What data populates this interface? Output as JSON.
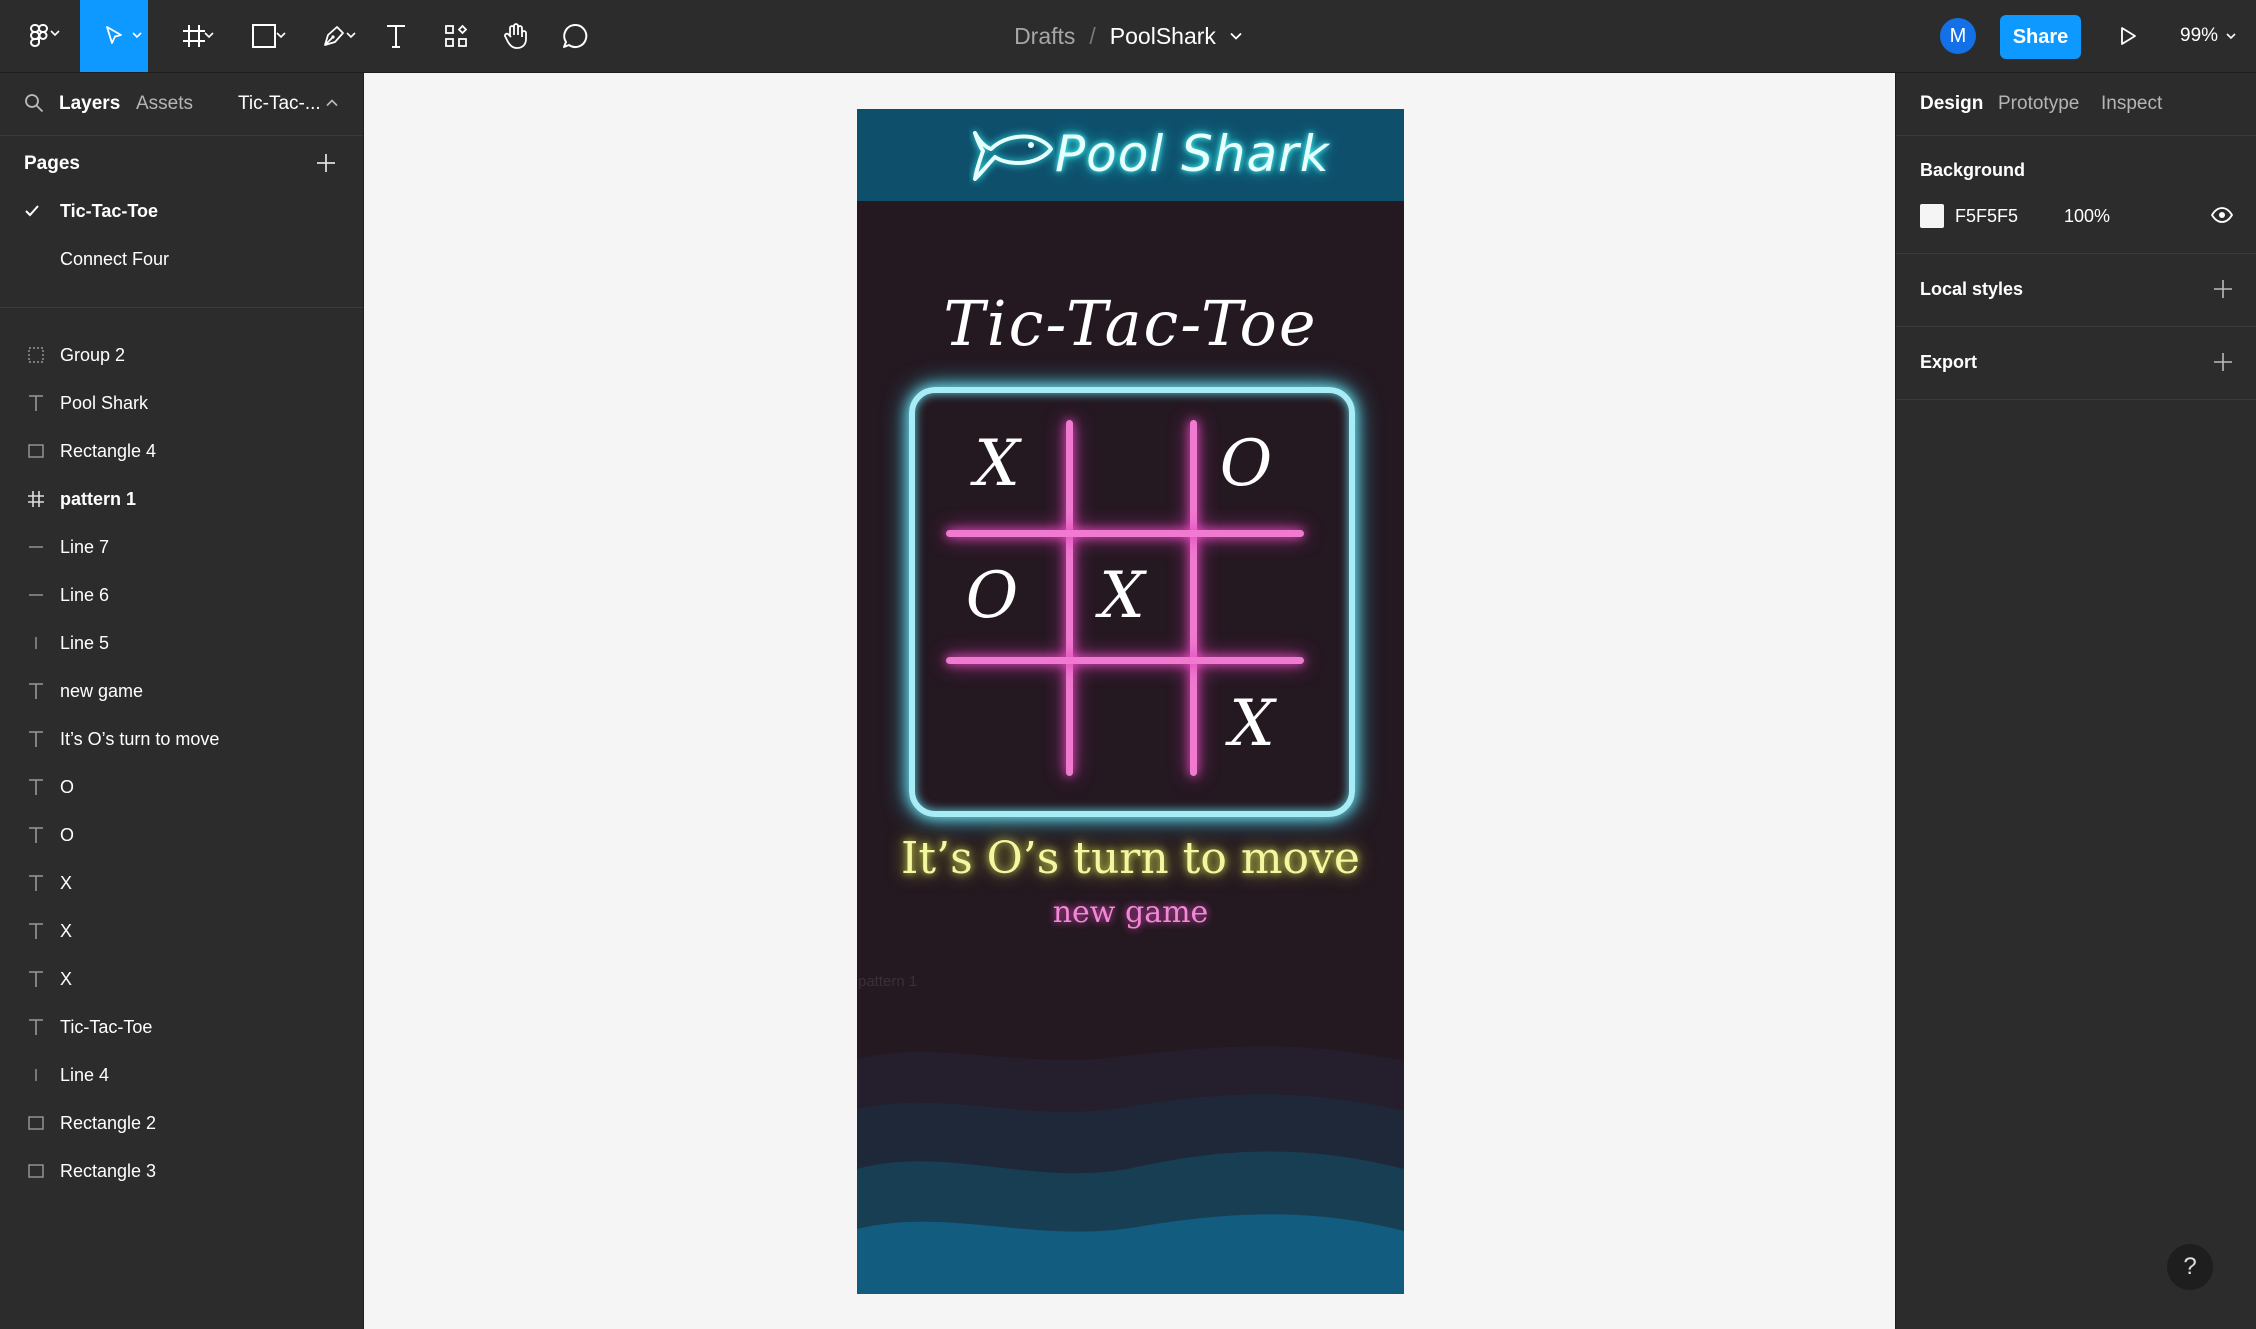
{
  "toolbar": {
    "file_breadcrumb": {
      "folder": "Drafts",
      "separator": "/",
      "file": "PoolShark"
    },
    "avatar_initial": "M",
    "share_label": "Share",
    "zoom_level": "99%",
    "tools": [
      "figma-menu-icon",
      "move-tool-icon",
      "frame-tool-icon",
      "shape-tool-icon",
      "pen-tool-icon",
      "text-tool-icon",
      "components-icon",
      "hand-tool-icon",
      "comment-icon"
    ]
  },
  "left_panel": {
    "tabs": [
      "Layers",
      "Assets"
    ],
    "current_page_short": "Tic-Tac-...",
    "pages_title": "Pages",
    "pages": [
      {
        "label": "Tic-Tac-Toe",
        "selected": true
      },
      {
        "label": "Connect Four",
        "selected": false
      }
    ],
    "layers": [
      {
        "label": "Group 2",
        "icon": "group-icon"
      },
      {
        "label": "Pool Shark",
        "icon": "text-icon"
      },
      {
        "label": "Rectangle 4",
        "icon": "rectangle-icon"
      },
      {
        "label": "pattern 1",
        "icon": "frame-icon"
      },
      {
        "label": "Line 7",
        "icon": "line-icon"
      },
      {
        "label": "Line 6",
        "icon": "line-icon"
      },
      {
        "label": "Line 5",
        "icon": "vertical-line-icon"
      },
      {
        "label": "new game",
        "icon": "text-icon"
      },
      {
        "label": "It’s O’s turn to move",
        "icon": "text-icon"
      },
      {
        "label": "O",
        "icon": "text-icon"
      },
      {
        "label": "O",
        "icon": "text-icon"
      },
      {
        "label": "X",
        "icon": "text-icon"
      },
      {
        "label": "X",
        "icon": "text-icon"
      },
      {
        "label": "X",
        "icon": "text-icon"
      },
      {
        "label": "Tic-Tac-Toe",
        "icon": "text-icon"
      },
      {
        "label": "Line 4",
        "icon": "vertical-line-icon"
      },
      {
        "label": "Rectangle 2",
        "icon": "rectangle-icon"
      },
      {
        "label": "Rectangle 3",
        "icon": "rectangle-icon"
      }
    ]
  },
  "right_panel": {
    "tabs": [
      "Design",
      "Prototype",
      "Inspect"
    ],
    "background_title": "Background",
    "background_hex": "F5F5F5",
    "background_opacity": "100%",
    "local_styles_title": "Local styles",
    "export_title": "Export"
  },
  "canvas": {
    "background_color": "#f5f5f5",
    "frame": {
      "brand": "Pool Shark",
      "title": "Tic-Tac-Toe",
      "board": [
        [
          "X",
          "",
          "O"
        ],
        [
          "O",
          "X",
          ""
        ],
        [
          "",
          "",
          "X"
        ]
      ],
      "turn_text": "It’s O’s turn to move",
      "new_game": "new game",
      "hidden_label": "pattern 1"
    }
  },
  "help_label": "?",
  "colors": {
    "toolbar_bg": "#2c2c2c",
    "accent": "#0d99ff",
    "frame_bg": "#241821",
    "header_bg": "#0e4f6c",
    "board_border": "#a8ecf5",
    "grid_lines": "#f07ad0",
    "turn_text": "#f3f7a2",
    "new_game_text": "#f387d8"
  }
}
